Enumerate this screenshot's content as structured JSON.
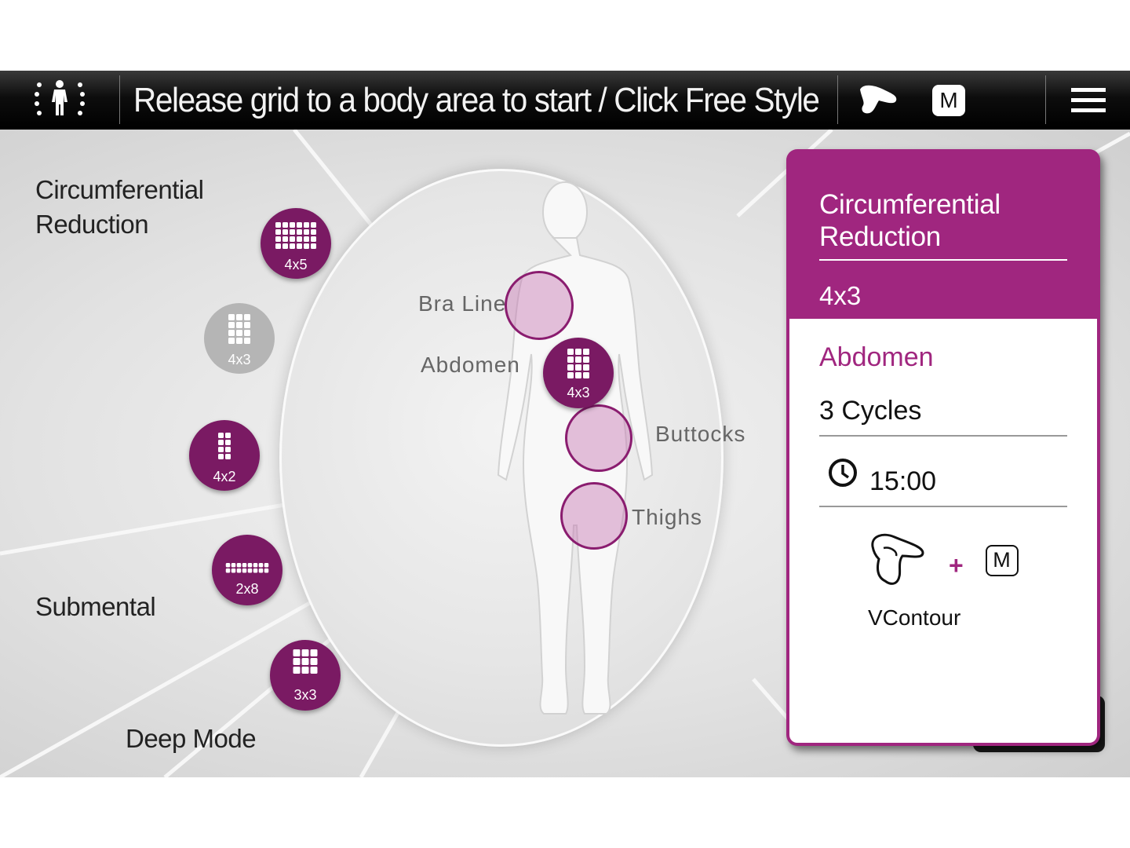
{
  "topbar": {
    "title": "Release grid to a body area to start / Click Free Style",
    "icons": [
      "body-grid-icon",
      "applicator-icon",
      "mode-m-icon",
      "hamburger-menu-icon"
    ],
    "mode_letter": "M"
  },
  "sections": {
    "circumferential": "Circumferential\nReduction",
    "submental": "Submental",
    "deep_mode": "Deep Mode"
  },
  "grids": [
    {
      "label": "4x5",
      "enabled": true
    },
    {
      "label": "4x3",
      "enabled": false
    },
    {
      "label": "4x2",
      "enabled": true
    },
    {
      "label": "2x8",
      "enabled": true
    },
    {
      "label": "3x3",
      "enabled": true
    }
  ],
  "body_areas": {
    "bra_line": "Bra Line",
    "abdomen": "Abdomen",
    "buttocks": "Buttocks",
    "thighs": "Thighs",
    "placed_grid": "4x3"
  },
  "panel": {
    "title": "Circumferential\nReduction",
    "grid": "4x3",
    "area": "Abdomen",
    "cycles": "3 Cycles",
    "time": "15:00",
    "plus": "+",
    "mode_letter": "M",
    "applicator": "VContour"
  },
  "colors": {
    "accent": "#a0267f",
    "grid_button": "#7a1a63",
    "disabled": "#b5b5b5"
  }
}
